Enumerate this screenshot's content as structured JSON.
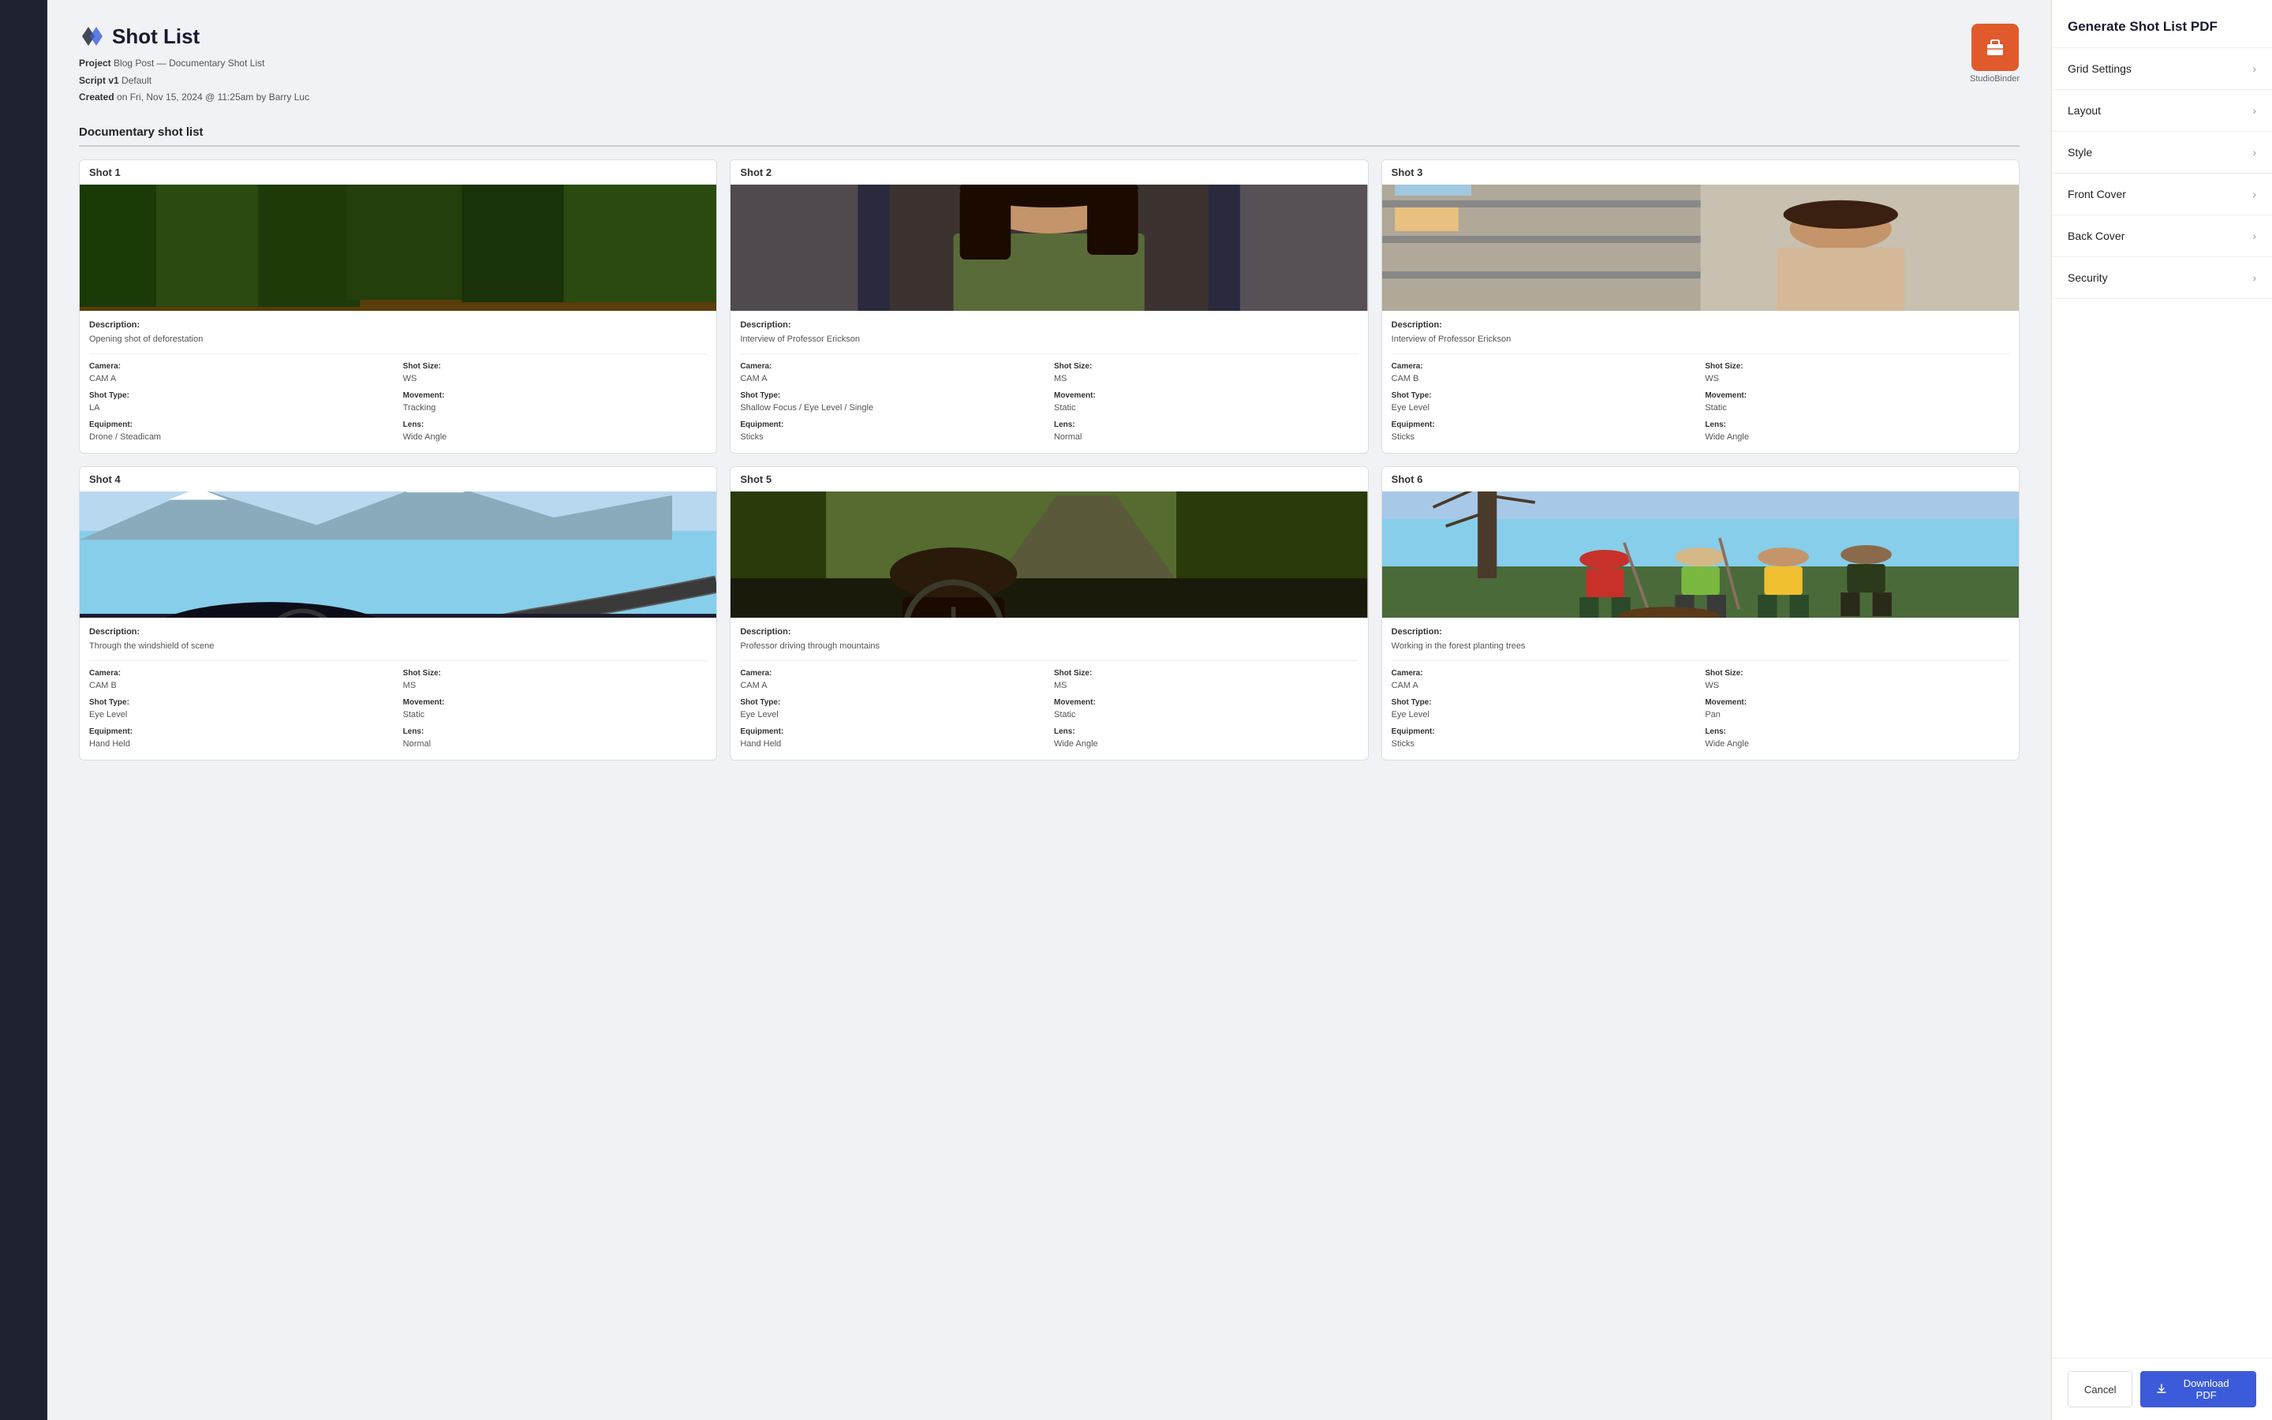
{
  "app": {
    "title": "Shot List"
  },
  "header": {
    "title": "Shot List",
    "project_label": "Project",
    "project_value": "Blog Post — Documentary Shot List",
    "script_label": "Script v1",
    "script_value": "Default",
    "created_label": "Created",
    "created_value": "on Fri, Nov 15, 2024 @ 11:25am by Barry Luc",
    "studio_name": "StudioBinder"
  },
  "section_title": "Documentary shot list",
  "shots": [
    {
      "number": "Shot  1",
      "description_label": "Description:",
      "description": "Opening shot of deforestation",
      "camera_label": "Camera:",
      "camera": "CAM A",
      "shot_size_label": "Shot Size:",
      "shot_size": "WS",
      "shot_type_label": "Shot Type:",
      "shot_type": "LA",
      "movement_label": "Movement:",
      "movement": "Tracking",
      "equipment_label": "Equipment:",
      "equipment": "Drone / Steadicam",
      "lens_label": "Lens:",
      "lens": "Wide Angle",
      "img_type": "forest"
    },
    {
      "number": "Shot  2",
      "description_label": "Description:",
      "description": "Interview of Professor Erickson",
      "camera_label": "Camera:",
      "camera": "CAM A",
      "shot_size_label": "Shot Size:",
      "shot_size": "MS",
      "shot_type_label": "Shot Type:",
      "shot_type": "Shallow Focus / Eye Level / Single",
      "movement_label": "Movement:",
      "movement": "Static",
      "equipment_label": "Equipment:",
      "equipment": "Sticks",
      "lens_label": "Lens:",
      "lens": "Normal",
      "img_type": "woman"
    },
    {
      "number": "Shot  3",
      "description_label": "Description:",
      "description": "Interview of Professor Erickson",
      "camera_label": "Camera:",
      "camera": "CAM B",
      "shot_size_label": "Shot Size:",
      "shot_size": "WS",
      "shot_type_label": "Shot Type:",
      "shot_type": "Eye Level",
      "movement_label": "Movement:",
      "movement": "Static",
      "equipment_label": "Equipment:",
      "equipment": "Sticks",
      "lens_label": "Lens:",
      "lens": "Wide Angle",
      "img_type": "warehouse"
    },
    {
      "number": "Shot  4",
      "description_label": "Description:",
      "description": "Through the windshield of scene",
      "camera_label": "Camera:",
      "camera": "CAM B",
      "shot_size_label": "Shot Size:",
      "shot_size": "MS",
      "shot_type_label": "Shot Type:",
      "shot_type": "Eye Level",
      "movement_label": "Movement:",
      "movement": "Static",
      "equipment_label": "Equipment:",
      "equipment": "Hand Held",
      "lens_label": "Lens:",
      "lens": "Normal",
      "img_type": "mountain"
    },
    {
      "number": "Shot  5",
      "description_label": "Description:",
      "description": "Professor driving through mountains",
      "camera_label": "Camera:",
      "camera": "CAM A",
      "shot_size_label": "Shot Size:",
      "shot_size": "MS",
      "shot_type_label": "Shot Type:",
      "shot_type": "Eye Level",
      "movement_label": "Movement:",
      "movement": "Static",
      "equipment_label": "Equipment:",
      "equipment": "Hand Held",
      "lens_label": "Lens:",
      "lens": "Wide Angle",
      "img_type": "car"
    },
    {
      "number": "Shot  6",
      "description_label": "Description:",
      "description": "Working in the forest planting trees",
      "camera_label": "Camera:",
      "camera": "CAM A",
      "shot_size_label": "Shot Size:",
      "shot_size": "WS",
      "shot_type_label": "Shot Type:",
      "shot_type": "Eye Level",
      "movement_label": "Movement:",
      "movement": "Pan",
      "equipment_label": "Equipment:",
      "equipment": "Sticks",
      "lens_label": "Lens:",
      "lens": "Wide Angle",
      "img_type": "trees"
    }
  ],
  "panel": {
    "title": "Generate Shot List PDF",
    "items": [
      {
        "label": "Grid Settings",
        "id": "grid-settings"
      },
      {
        "label": "Layout",
        "id": "layout"
      },
      {
        "label": "Style",
        "id": "style"
      },
      {
        "label": "Front Cover",
        "id": "front-cover"
      },
      {
        "label": "Back Cover",
        "id": "back-cover"
      },
      {
        "label": "Security",
        "id": "security"
      }
    ],
    "cancel_label": "Cancel",
    "download_label": "Download PDF"
  }
}
